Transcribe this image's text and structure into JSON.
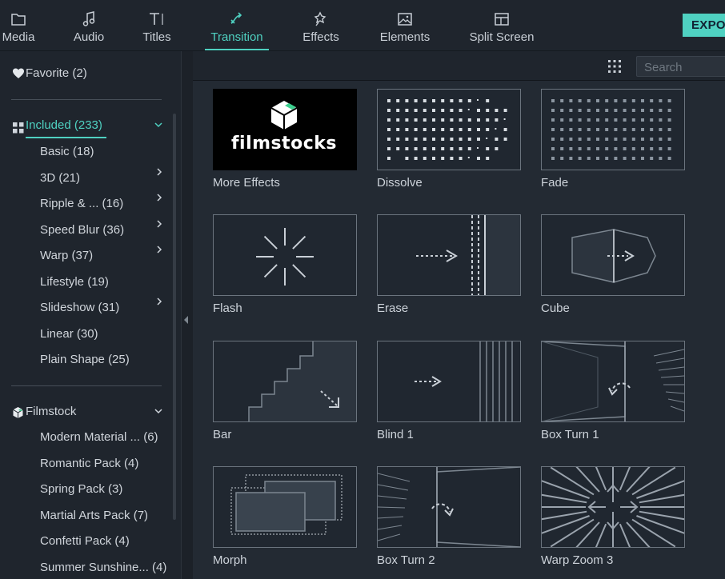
{
  "toolbar": {
    "tabs": [
      {
        "label": "Media",
        "icon": "folder-icon"
      },
      {
        "label": "Audio",
        "icon": "music-note-icon"
      },
      {
        "label": "Titles",
        "icon": "text-icon"
      },
      {
        "label": "Transition",
        "icon": "transition-icon",
        "active": true
      },
      {
        "label": "Effects",
        "icon": "effects-icon"
      },
      {
        "label": "Elements",
        "icon": "image-icon"
      },
      {
        "label": "Split Screen",
        "icon": "split-screen-icon"
      }
    ],
    "export_label": "EXPO",
    "accent": "#4fd1c1"
  },
  "sidebar": {
    "favorite": {
      "label": "Favorite (2)",
      "icon": "heart-icon"
    },
    "included": {
      "label": "Included (233)",
      "icon": "grid-icon"
    },
    "included_items": [
      {
        "label": "Basic (18)",
        "has_chevron": false
      },
      {
        "label": "3D (21)",
        "has_chevron": true
      },
      {
        "label": "Ripple & ... (16)",
        "has_chevron": true
      },
      {
        "label": "Speed Blur (36)",
        "has_chevron": true
      },
      {
        "label": "Warp (37)",
        "has_chevron": true
      },
      {
        "label": "Lifestyle (19)",
        "has_chevron": false
      },
      {
        "label": "Slideshow (31)",
        "has_chevron": true
      },
      {
        "label": "Linear (30)",
        "has_chevron": false
      },
      {
        "label": "Plain Shape (25)",
        "has_chevron": false
      }
    ],
    "filmstock": {
      "label": "Filmstock",
      "icon": "filmstock-cube-icon"
    },
    "filmstock_items": [
      {
        "label": "Modern Material ... (6)"
      },
      {
        "label": "Romantic Pack (4)"
      },
      {
        "label": "Spring Pack (3)"
      },
      {
        "label": "Martial Arts Pack (7)"
      },
      {
        "label": "Confetti Pack (4)"
      },
      {
        "label": "Summer Sunshine... (4)"
      }
    ]
  },
  "search": {
    "placeholder": "Search"
  },
  "cards": [
    {
      "label": "More Effects",
      "icon": "filmstocks-logo",
      "logo_text": "filmstocks"
    },
    {
      "label": "Dissolve",
      "icon": "dissolve-icon"
    },
    {
      "label": "Fade",
      "icon": "fade-icon"
    },
    {
      "label": "Flash",
      "icon": "flash-icon"
    },
    {
      "label": "Erase",
      "icon": "erase-icon"
    },
    {
      "label": "Cube",
      "icon": "cube-icon"
    },
    {
      "label": "Bar",
      "icon": "bar-stairs-icon"
    },
    {
      "label": "Blind 1",
      "icon": "blind-icon"
    },
    {
      "label": "Box Turn 1",
      "icon": "box-turn-1-icon"
    },
    {
      "label": "Morph",
      "icon": "morph-icon"
    },
    {
      "label": "Box Turn 2",
      "icon": "box-turn-2-icon"
    },
    {
      "label": "Warp Zoom 3",
      "icon": "warp-zoom-icon"
    }
  ]
}
